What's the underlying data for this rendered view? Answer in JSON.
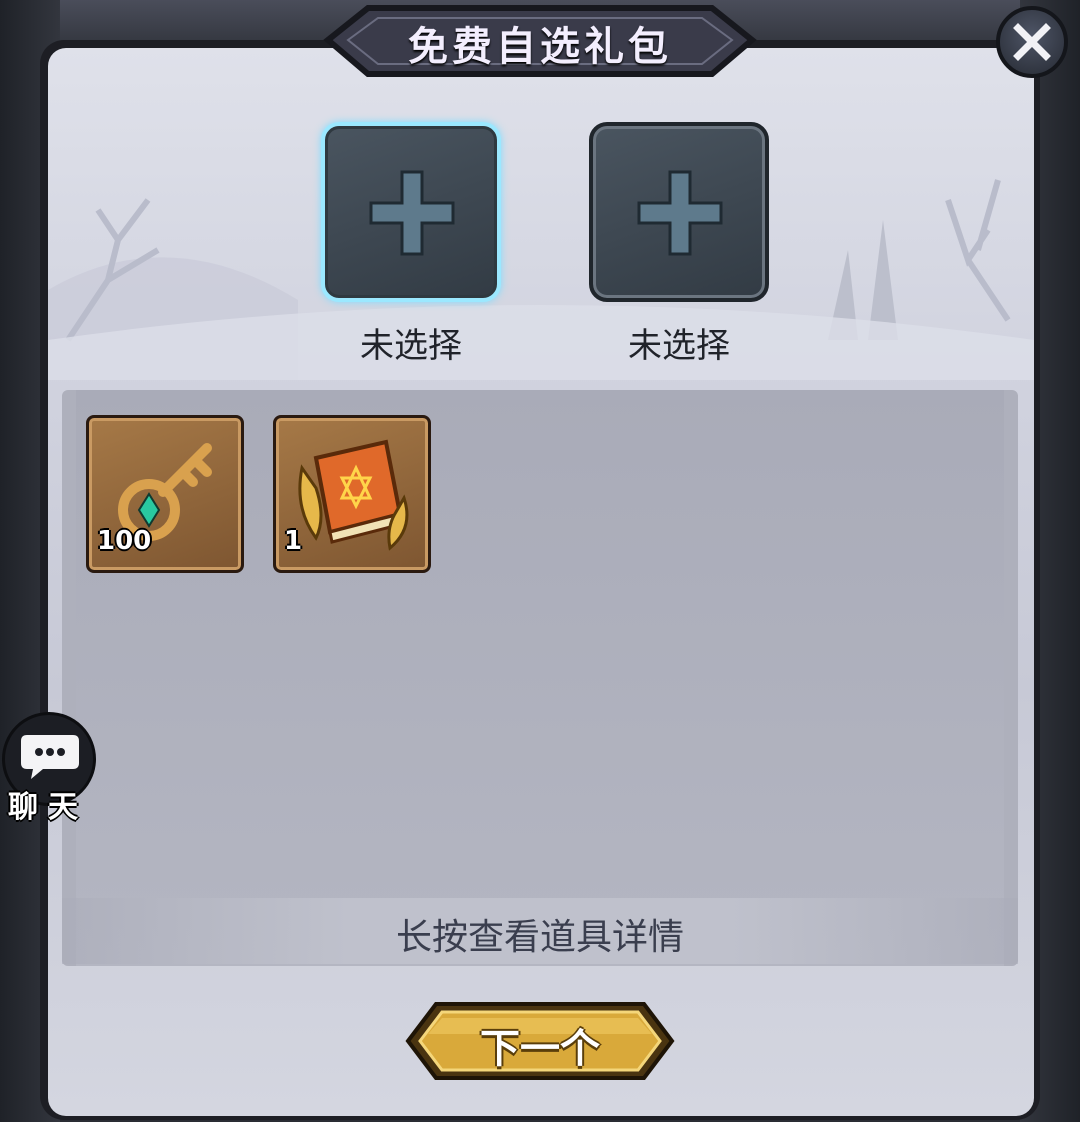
{
  "dialog": {
    "title": "免费自选礼包",
    "close_icon": "close-icon"
  },
  "slots": [
    {
      "label": "未选择",
      "icon": "plus-icon",
      "selected": true
    },
    {
      "label": "未选择",
      "icon": "plus-icon",
      "selected": false
    }
  ],
  "items": [
    {
      "icon": "key-icon",
      "count": "100"
    },
    {
      "icon": "spellbook-icon",
      "count": "1"
    }
  ],
  "hint": "长按查看道具详情",
  "next_button": {
    "label": "下一个"
  },
  "chat": {
    "label": "聊天",
    "icon": "chat-bubble-icon"
  },
  "colors": {
    "selected_slot_border": "#9be8ff",
    "item_frame": "#a67947",
    "next_button_gold": "#d9a93a"
  }
}
